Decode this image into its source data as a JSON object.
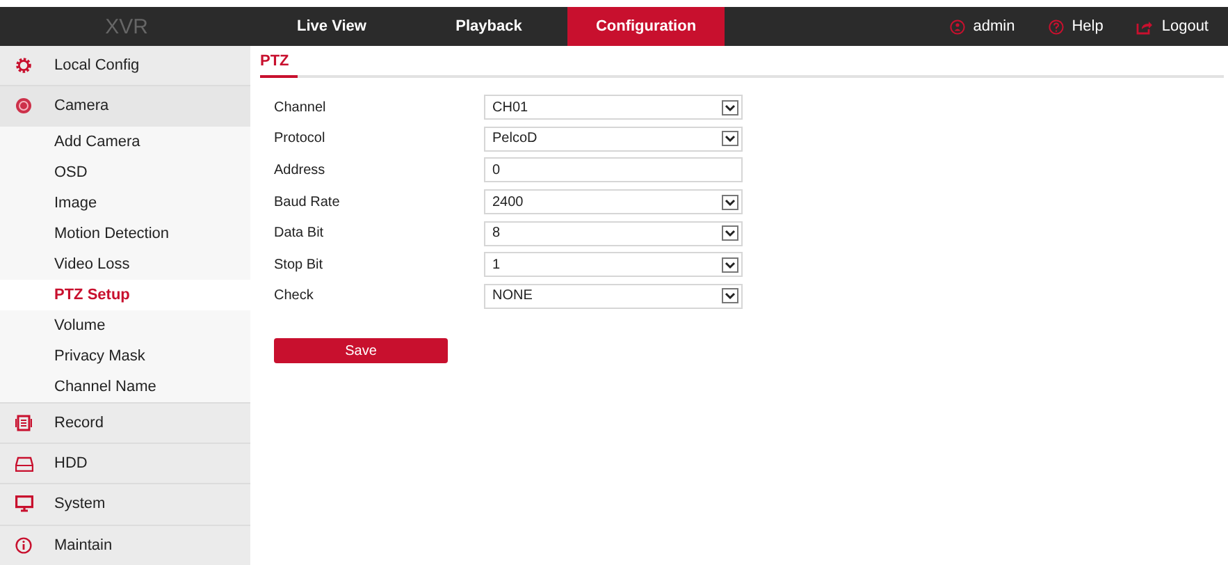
{
  "header": {
    "logo": "XVR",
    "tabs": [
      {
        "label": "Live View",
        "selected": false
      },
      {
        "label": "Playback",
        "selected": false
      },
      {
        "label": "Configuration",
        "selected": true
      }
    ],
    "user": "admin",
    "help": "Help",
    "logout": "Logout"
  },
  "sidebar": {
    "items": [
      {
        "label": "Local Config",
        "expanded": false
      },
      {
        "label": "Camera",
        "expanded": true,
        "children": [
          {
            "label": "Add Camera",
            "selected": false
          },
          {
            "label": "OSD",
            "selected": false
          },
          {
            "label": "Image",
            "selected": false
          },
          {
            "label": "Motion Detection",
            "selected": false
          },
          {
            "label": "Video Loss",
            "selected": false
          },
          {
            "label": "PTZ Setup",
            "selected": true
          },
          {
            "label": "Volume",
            "selected": false
          },
          {
            "label": "Privacy Mask",
            "selected": false
          },
          {
            "label": "Channel Name",
            "selected": false
          }
        ]
      },
      {
        "label": "Record",
        "expanded": false
      },
      {
        "label": "HDD",
        "expanded": false
      },
      {
        "label": "System",
        "expanded": false
      },
      {
        "label": "Maintain",
        "expanded": false
      }
    ]
  },
  "content": {
    "tab": "PTZ",
    "fields": [
      {
        "label": "Channel",
        "kind": "select",
        "value": "CH01"
      },
      {
        "label": "Protocol",
        "kind": "select",
        "value": "PelcoD"
      },
      {
        "label": "Address",
        "kind": "text",
        "value": "0"
      },
      {
        "label": "Baud Rate",
        "kind": "select",
        "value": "2400"
      },
      {
        "label": "Data Bit",
        "kind": "select",
        "value": "8"
      },
      {
        "label": "Stop Bit",
        "kind": "select",
        "value": "1"
      },
      {
        "label": "Check",
        "kind": "select",
        "value": "NONE"
      }
    ],
    "save": "Save"
  }
}
